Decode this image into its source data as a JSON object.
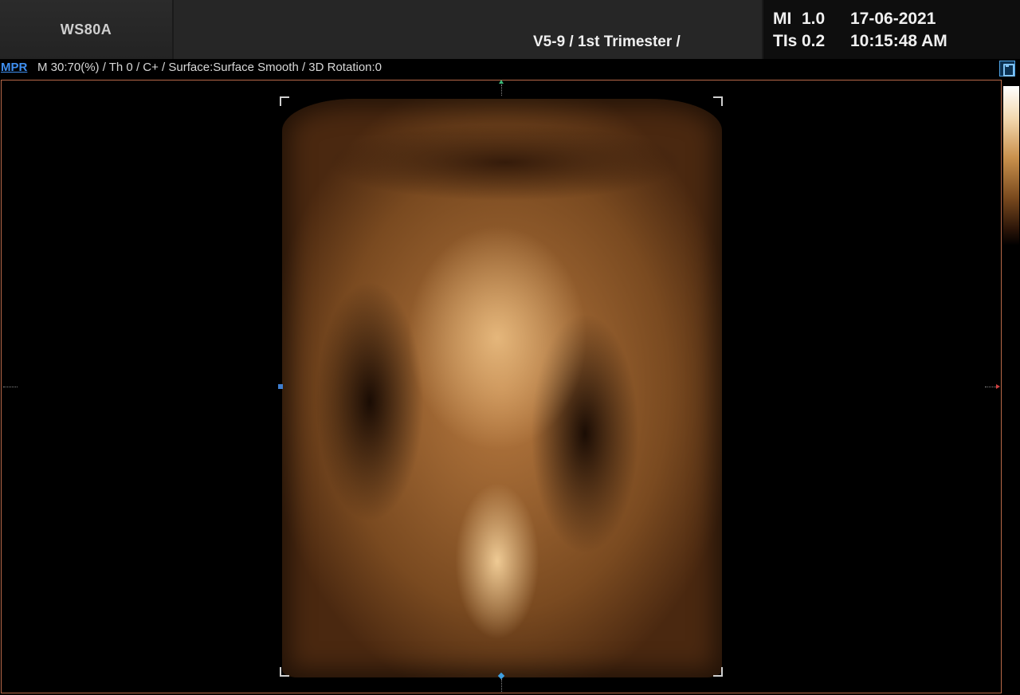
{
  "header": {
    "logo": "WS80A",
    "preset": "V5-9 / 1st Trimester /",
    "mi_label": "MI",
    "mi_value": "1.0",
    "tis_label": "TIs",
    "tis_value": "0.2",
    "date": "17-06-2021",
    "time": "10:15:48 AM"
  },
  "status": {
    "mode": "MPR",
    "params": "M 30:70(%) / Th 0 / C+ / Surface:Surface Smooth / 3D Rotation:0"
  },
  "colors": {
    "accent": "#3f8ff0",
    "frame": "#b86848",
    "volume_tone": "#b87a40"
  },
  "icons": {
    "save": "save-icon"
  }
}
